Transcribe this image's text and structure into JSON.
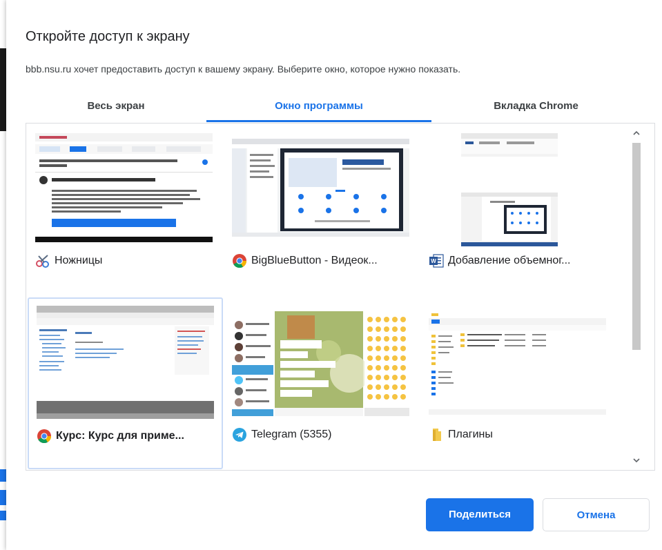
{
  "dialog": {
    "title": "Откройте доступ к экрану",
    "description": "bbb.nsu.ru хочет предоставить доступ к вашему экрану. Выберите окно, которое нужно показать."
  },
  "tabs": [
    {
      "label": "Весь экран",
      "active": false
    },
    {
      "label": "Окно программы",
      "active": true
    },
    {
      "label": "Вкладка Chrome",
      "active": false
    }
  ],
  "windows": [
    {
      "label": "Ножницы",
      "icon": "scissors-icon",
      "selected": false
    },
    {
      "label": "BigBlueButton - Видеок...",
      "icon": "chrome-icon",
      "selected": false
    },
    {
      "label": "Добавление объемног...",
      "icon": "word-icon",
      "selected": false
    },
    {
      "label": "Курс: Курс для приме...",
      "icon": "chrome-icon",
      "selected": true
    },
    {
      "label": "Telegram (5355)",
      "icon": "telegram-icon",
      "selected": false
    },
    {
      "label": "Плагины",
      "icon": "folder-icon",
      "selected": false
    }
  ],
  "buttons": {
    "share": "Поделиться",
    "cancel": "Отмена"
  },
  "colors": {
    "accent": "#1a73e8",
    "border": "#dadce0"
  }
}
